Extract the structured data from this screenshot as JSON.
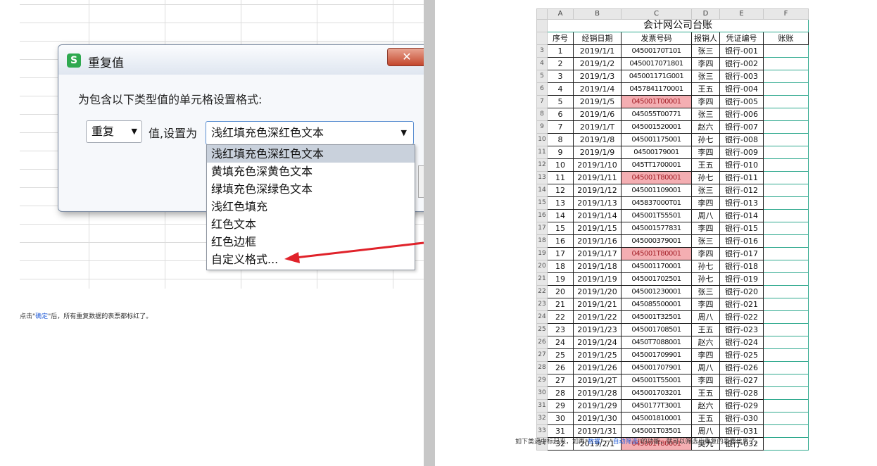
{
  "dialog": {
    "title": "重复值",
    "logo": "S",
    "close_label": "✕",
    "instruction": "为包含以下类型值的单元格设置格式:",
    "value_type": "重复",
    "set_as_label": "值,设置为",
    "format_selected": "浅红填充色深红色文本",
    "dropdown_arrow": "▼"
  },
  "dropdown": {
    "items": [
      "浅红填充色深红色文本",
      "黄填充色深黄色文本",
      "绿填充色深绿色文本",
      "浅红色填充",
      "红色文本",
      "红色边框",
      "自定义格式..."
    ],
    "selected_index": 0
  },
  "left_caption": {
    "prefix": "点击\"",
    "highlight": "确定",
    "suffix": "\"后，所有重复数据的表票都标红了。"
  },
  "sheet": {
    "columns": [
      "A",
      "B",
      "C",
      "D",
      "E",
      "F"
    ],
    "title": "会计网公司台账",
    "headers": [
      "序号",
      "经销日期",
      "发票号码",
      "报销人",
      "凭证编号",
      "账账"
    ],
    "rows": [
      {
        "rn": "3",
        "seq": "1",
        "date": "2019/1/1",
        "inv": "04500170T101",
        "person": "张三",
        "voucher": "银行-001",
        "dup": false
      },
      {
        "rn": "4",
        "seq": "2",
        "date": "2019/1/2",
        "inv": "0450017071801",
        "person": "李四",
        "voucher": "银行-002",
        "dup": false
      },
      {
        "rn": "5",
        "seq": "3",
        "date": "2019/1/3",
        "inv": "045001171G001",
        "person": "张三",
        "voucher": "银行-003",
        "dup": false
      },
      {
        "rn": "6",
        "seq": "4",
        "date": "2019/1/4",
        "inv": "0457841170001",
        "person": "王五",
        "voucher": "银行-004",
        "dup": false
      },
      {
        "rn": "7",
        "seq": "5",
        "date": "2019/1/5",
        "inv": "045001T00001",
        "person": "李四",
        "voucher": "银行-005",
        "dup": true
      },
      {
        "rn": "8",
        "seq": "6",
        "date": "2019/1/6",
        "inv": "045055T00771",
        "person": "张三",
        "voucher": "银行-006",
        "dup": false
      },
      {
        "rn": "9",
        "seq": "7",
        "date": "2019/1/T",
        "inv": "045001520001",
        "person": "赵六",
        "voucher": "银行-007",
        "dup": false
      },
      {
        "rn": "10",
        "seq": "8",
        "date": "2019/1/8",
        "inv": "045001175001",
        "person": "孙七",
        "voucher": "银行-008",
        "dup": false
      },
      {
        "rn": "11",
        "seq": "9",
        "date": "2019/1/9",
        "inv": "04500179001",
        "person": "李四",
        "voucher": "银行-009",
        "dup": false
      },
      {
        "rn": "12",
        "seq": "10",
        "date": "2019/1/10",
        "inv": "045TT1700001",
        "person": "王五",
        "voucher": "银行-010",
        "dup": false
      },
      {
        "rn": "13",
        "seq": "11",
        "date": "2019/1/11",
        "inv": "045001T80001",
        "person": "孙七",
        "voucher": "银行-011",
        "dup": true
      },
      {
        "rn": "14",
        "seq": "12",
        "date": "2019/1/12",
        "inv": "045001109001",
        "person": "张三",
        "voucher": "银行-012",
        "dup": false
      },
      {
        "rn": "15",
        "seq": "13",
        "date": "2019/1/13",
        "inv": "045837000T01",
        "person": "李四",
        "voucher": "银行-013",
        "dup": false
      },
      {
        "rn": "16",
        "seq": "14",
        "date": "2019/1/14",
        "inv": "045001T55501",
        "person": "周八",
        "voucher": "银行-014",
        "dup": false
      },
      {
        "rn": "17",
        "seq": "15",
        "date": "2019/1/15",
        "inv": "045001577831",
        "person": "李四",
        "voucher": "银行-015",
        "dup": false
      },
      {
        "rn": "18",
        "seq": "16",
        "date": "2019/1/16",
        "inv": "045000379001",
        "person": "张三",
        "voucher": "银行-016",
        "dup": false
      },
      {
        "rn": "19",
        "seq": "17",
        "date": "2019/1/17",
        "inv": "045001T80001",
        "person": "李四",
        "voucher": "银行-017",
        "dup": true
      },
      {
        "rn": "20",
        "seq": "18",
        "date": "2019/1/18",
        "inv": "045001170001",
        "person": "孙七",
        "voucher": "银行-018",
        "dup": false
      },
      {
        "rn": "21",
        "seq": "19",
        "date": "2019/1/19",
        "inv": "045001702501",
        "person": "孙七",
        "voucher": "银行-019",
        "dup": false
      },
      {
        "rn": "22",
        "seq": "20",
        "date": "2019/1/20",
        "inv": "045001230001",
        "person": "张三",
        "voucher": "银行-020",
        "dup": false
      },
      {
        "rn": "23",
        "seq": "21",
        "date": "2019/1/21",
        "inv": "045085500001",
        "person": "李四",
        "voucher": "银行-021",
        "dup": false
      },
      {
        "rn": "24",
        "seq": "22",
        "date": "2019/1/22",
        "inv": "045001T32501",
        "person": "周八",
        "voucher": "银行-022",
        "dup": false
      },
      {
        "rn": "25",
        "seq": "23",
        "date": "2019/1/23",
        "inv": "045001708501",
        "person": "王五",
        "voucher": "银行-023",
        "dup": false
      },
      {
        "rn": "26",
        "seq": "24",
        "date": "2019/1/24",
        "inv": "0450T7088001",
        "person": "赵六",
        "voucher": "银行-024",
        "dup": false
      },
      {
        "rn": "27",
        "seq": "25",
        "date": "2019/1/25",
        "inv": "045001709901",
        "person": "李四",
        "voucher": "银行-025",
        "dup": false
      },
      {
        "rn": "28",
        "seq": "26",
        "date": "2019/1/26",
        "inv": "045001707901",
        "person": "周八",
        "voucher": "银行-026",
        "dup": false
      },
      {
        "rn": "29",
        "seq": "27",
        "date": "2019/1/2T",
        "inv": "045001T55001",
        "person": "李四",
        "voucher": "银行-027",
        "dup": false
      },
      {
        "rn": "30",
        "seq": "28",
        "date": "2019/1/28",
        "inv": "045001703201",
        "person": "王五",
        "voucher": "银行-028",
        "dup": false
      },
      {
        "rn": "31",
        "seq": "29",
        "date": "2019/1/29",
        "inv": "0450177T3001",
        "person": "赵六",
        "voucher": "银行-029",
        "dup": false
      },
      {
        "rn": "32",
        "seq": "30",
        "date": "2019/1/30",
        "inv": "045001810001",
        "person": "王五",
        "voucher": "银行-030",
        "dup": false
      },
      {
        "rn": "33",
        "seq": "31",
        "date": "2019/1/31",
        "inv": "045001T03501",
        "person": "周八",
        "voucher": "银行-031",
        "dup": false
      },
      {
        "rn": "34",
        "seq": "32",
        "date": "2019/2/1",
        "inv": "045001T80001",
        "person": "吴九",
        "voucher": "银行-032",
        "dup": true
      }
    ]
  },
  "right_caption": {
    "prefix": "如下类递中标起来，如再\"",
    "highlight1": "数据",
    "middle": "\"一\"",
    "highlight2": "自动筛选",
    "suffix": "\"的功能，就可以筛选出重复的表票信息了。"
  },
  "colors": {
    "duplicate_fill": "#f4aeb2",
    "duplicate_text": "#a42028",
    "teal_border": "#2fa98e",
    "wps_green": "#2fa950",
    "arrow_red": "#e0222a"
  }
}
